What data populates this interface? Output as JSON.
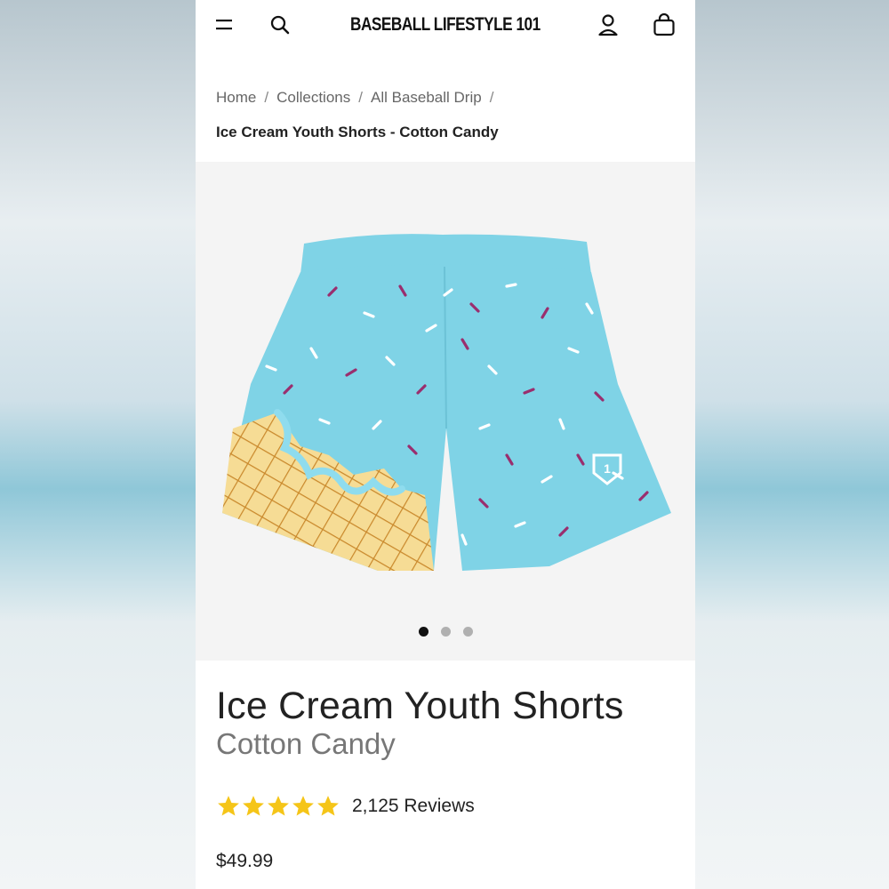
{
  "header": {
    "brand": "BASEBALL LIFESTYLE 101",
    "icons": [
      "menu-icon",
      "search-icon",
      "account-icon",
      "cart-icon"
    ]
  },
  "breadcrumb": {
    "items": [
      "Home",
      "Collections",
      "All Baseball Drip"
    ],
    "separator": "/",
    "current": "Ice Cream Youth Shorts - Cotton Candy"
  },
  "gallery": {
    "image": "ice-cream-shorts-photo",
    "slide_count": 3,
    "active_slide": 1
  },
  "product": {
    "title": "Ice Cream Youth Shorts",
    "variant": "Cotton Candy",
    "rating": 5,
    "reviews": "2,125 Reviews",
    "price": "$49.99"
  },
  "colors": {
    "star": "#f5c518",
    "shorts": "#7fd3e6",
    "sprinkle_purple": "#9a2e6e",
    "cone": "#f3d38a"
  }
}
